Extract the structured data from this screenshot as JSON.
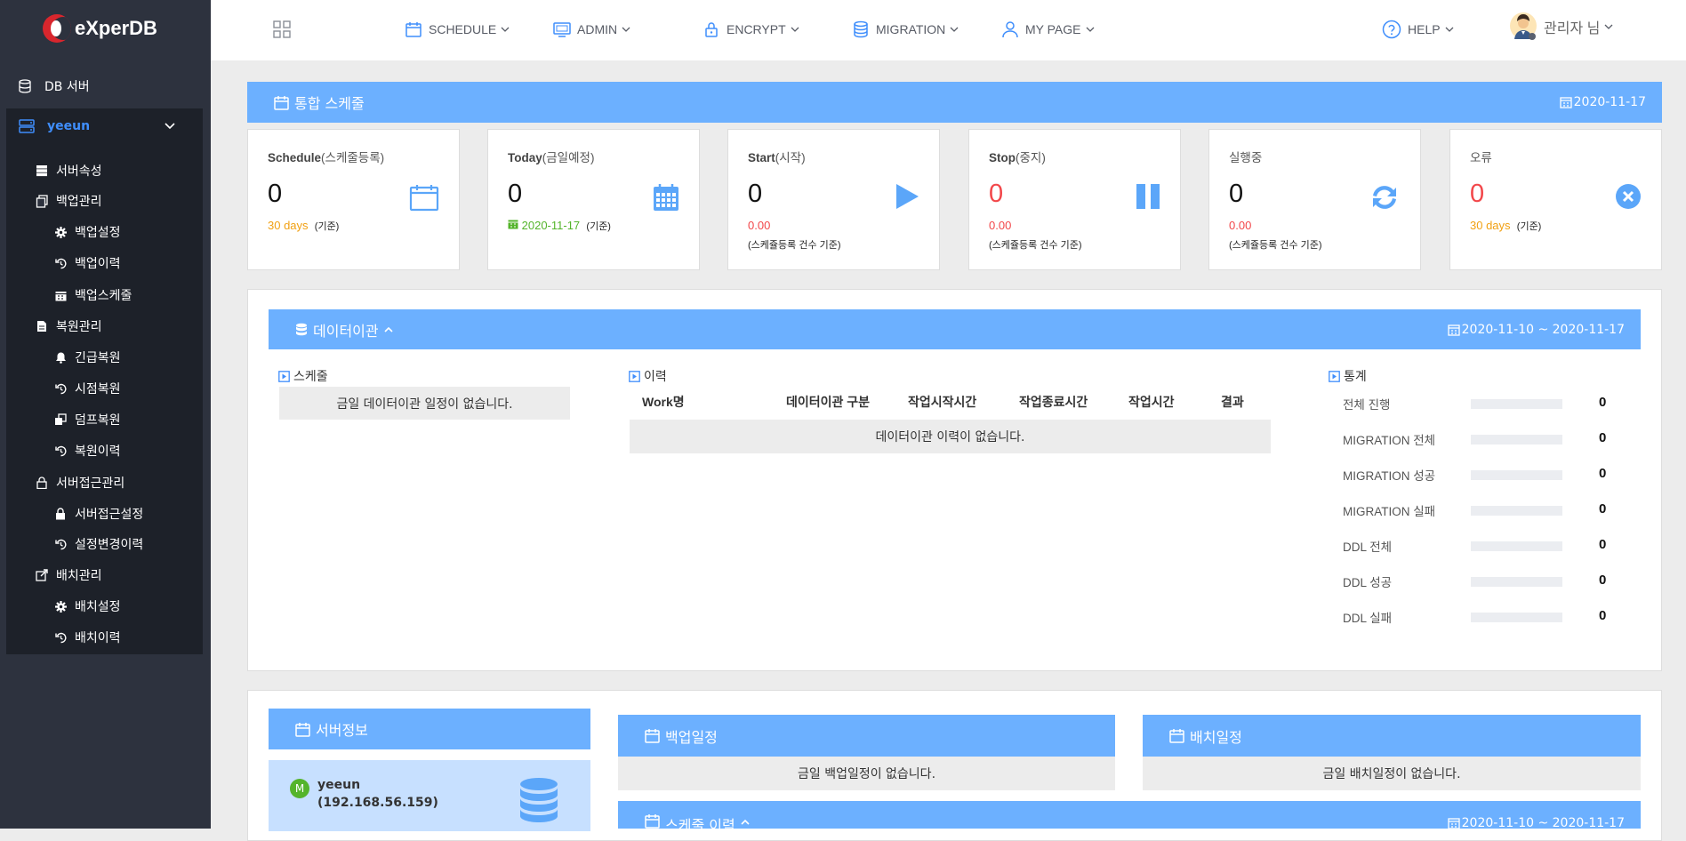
{
  "brand": {
    "logo_text": "eXperDB"
  },
  "sidebar": {
    "db_server_label": "DB 서버",
    "server_name": "yeeun",
    "items": [
      {
        "label": "서버속성",
        "icon": "server-icon",
        "level": 1
      },
      {
        "label": "백업관리",
        "icon": "copy-icon",
        "level": 1
      },
      {
        "label": "백업설정",
        "icon": "gear-icon",
        "level": 2
      },
      {
        "label": "백업이력",
        "icon": "history-icon",
        "level": 2
      },
      {
        "label": "백업스케줄",
        "icon": "calendar-icon",
        "level": 2
      },
      {
        "label": "복원관리",
        "icon": "file-icon",
        "level": 1
      },
      {
        "label": "긴급복원",
        "icon": "bell-icon",
        "level": 2
      },
      {
        "label": "시점복원",
        "icon": "history-icon",
        "level": 2
      },
      {
        "label": "덤프복원",
        "icon": "clone-icon",
        "level": 2
      },
      {
        "label": "복원이력",
        "icon": "history-icon",
        "level": 2
      },
      {
        "label": "서버접근관리",
        "icon": "lock-icon",
        "level": 1
      },
      {
        "label": "서버접근설정",
        "icon": "lock-icon",
        "level": 2
      },
      {
        "label": "설정변경이력",
        "icon": "history-icon",
        "level": 2
      },
      {
        "label": "배치관리",
        "icon": "share-icon",
        "level": 1
      },
      {
        "label": "배치설정",
        "icon": "gear-icon",
        "level": 2
      },
      {
        "label": "배치이력",
        "icon": "history-icon",
        "level": 2
      }
    ]
  },
  "header": {
    "nav": [
      {
        "label": "SCHEDULE",
        "icon": "calendar-icon"
      },
      {
        "label": "ADMIN",
        "icon": "monitor-icon"
      },
      {
        "label": "ENCRYPT",
        "icon": "lock-icon"
      },
      {
        "label": "MIGRATION",
        "icon": "database-icon"
      },
      {
        "label": "MY PAGE",
        "icon": "user-icon"
      }
    ],
    "help_label": "HELP",
    "user_label": "관리자 님"
  },
  "schedule": {
    "title": "통합 스케줄",
    "date": "2020-11-17",
    "cards": [
      {
        "title": "Schedule",
        "title_sub": "(스케줄등록)",
        "value": "0",
        "sub_value": "30 days",
        "sub_note": "(기준)",
        "icon": "calendar-icon"
      },
      {
        "title": "Today",
        "title_sub": "(금일예정)",
        "value": "0",
        "sub_value": "2020-11-17",
        "sub_note": "(기준)",
        "icon": "calendar-grid-icon"
      },
      {
        "title": "Start",
        "title_sub": "(시작)",
        "value": "0",
        "sub_value": "0.00",
        "sub_note": "(스케쥴등록 건수 기준)",
        "icon": "play-icon"
      },
      {
        "title": "Stop",
        "title_sub": "(중지)",
        "value": "0",
        "sub_value": "0.00",
        "sub_note": "(스케쥴등록 건수 기준)",
        "icon": "pause-icon"
      },
      {
        "title": "실행중",
        "title_sub": "",
        "value": "0",
        "sub_value": "0.00",
        "sub_note": "(스케쥴등록 건수 기준)",
        "icon": "refresh-icon"
      },
      {
        "title": "오류",
        "title_sub": "",
        "value": "0",
        "sub_value": "30 days",
        "sub_note": "(기준)",
        "icon": "close-circle-icon"
      }
    ]
  },
  "migration": {
    "title": "데이터이관",
    "date_range": "2020-11-10 ~ 2020-11-17",
    "schedule_title": "스케줄",
    "schedule_empty": "금일 데이터이관 일정이 없습니다.",
    "history_title": "이력",
    "columns": [
      "Work명",
      "데이터이관 구분",
      "작업시작시간",
      "작업종료시간",
      "작업시간",
      "결과"
    ],
    "history_empty": "데이터이관 이력이 없습니다.",
    "stats_title": "통계",
    "stats": [
      {
        "label": "전체 진행",
        "value": "0"
      },
      {
        "label": "MIGRATION 전체",
        "value": "0"
      },
      {
        "label": "MIGRATION 성공",
        "value": "0"
      },
      {
        "label": "MIGRATION 실패",
        "value": "0"
      },
      {
        "label": "DDL 전체",
        "value": "0"
      },
      {
        "label": "DDL 성공",
        "value": "0"
      },
      {
        "label": "DDL 실패",
        "value": "0"
      }
    ]
  },
  "server_info": {
    "title": "서버정보",
    "badge": "M",
    "name": "yeeun",
    "ip": "(192.168.56.159)"
  },
  "backup_schedule": {
    "title": "백업일정",
    "empty": "금일 백업일정이 없습니다."
  },
  "batch_schedule": {
    "title": "배치일정",
    "empty": "금일 배치일정이 없습니다."
  },
  "schedule_history": {
    "title": "스케줄 이력",
    "date_range": "2020-11-10 ~ 2020-11-17"
  },
  "colors": {
    "accent": "#6cb0ff",
    "sidebar": "#2d323e",
    "error": "#f2474a",
    "warning": "#f1a012",
    "success": "#54b42b"
  }
}
